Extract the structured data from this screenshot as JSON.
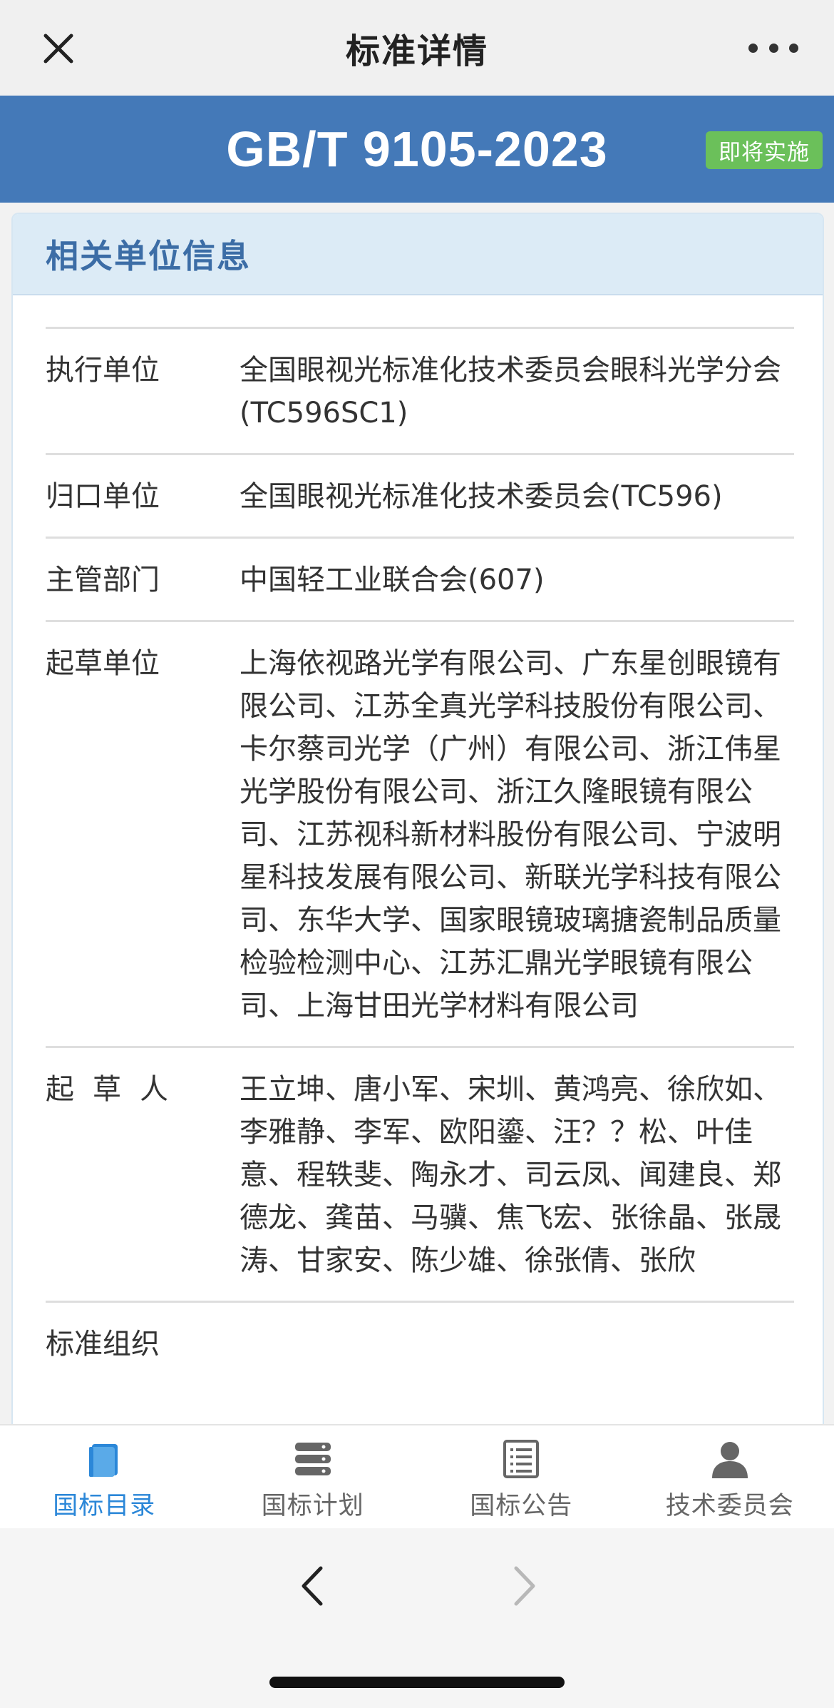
{
  "nav": {
    "title": "标准详情"
  },
  "header": {
    "code": "GB/T 9105-2023",
    "status": "即将实施",
    "status_color": "#6bc05a",
    "band_color": "#4479b8"
  },
  "section": {
    "title": "相关单位信息",
    "rows": [
      {
        "label": "执行单位",
        "value": "全国眼视光标准化技术委员会眼科光学分会(TC596SC1)"
      },
      {
        "label": "归口单位",
        "value": "全国眼视光标准化技术委员会(TC596)"
      },
      {
        "label": "主管部门",
        "value": "中国轻工业联合会(607)"
      },
      {
        "label": "起草单位",
        "value": "上海依视路光学有限公司、广东星创眼镜有限公司、江苏全真光学科技股份有限公司、卡尔蔡司光学（广州）有限公司、浙江伟星光学股份有限公司、浙江久隆眼镜有限公司、江苏视科新材料股份有限公司、宁波明星科技发展有限公司、新联光学科技有限公司、东华大学、国家眼镜玻璃搪瓷制品质量检验检测中心、江苏汇鼎光学眼镜有限公司、上海甘田光学材料有限公司"
      },
      {
        "label": "起草人",
        "value": "王立坤、唐小军、宋圳、黄鸿亮、徐欣如、李雅静、李军、欧阳鎏、汪？？松、叶佳意、程轶斐、陶永才、司云凤、闻建良、郑德龙、龚苗、马骥、焦飞宏、张徐晶、张晟涛、甘家安、陈少雄、徐张倩、张欣"
      },
      {
        "label": "标准组织",
        "value": ""
      }
    ]
  },
  "tabs": [
    {
      "label": "国标目录",
      "icon": "book-icon",
      "active": true
    },
    {
      "label": "国标计划",
      "icon": "stack-icon",
      "active": false
    },
    {
      "label": "国标公告",
      "icon": "document-icon",
      "active": false
    },
    {
      "label": "技术委员会",
      "icon": "person-icon",
      "active": false
    }
  ],
  "colors": {
    "accent": "#2b87d8",
    "section_title": "#3c6da6"
  }
}
